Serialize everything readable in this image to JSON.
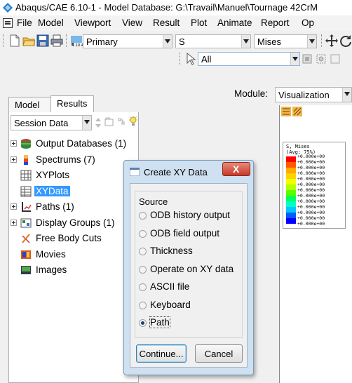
{
  "window": {
    "title": "Abaqus/CAE 6.10-1 - Model Database: G:\\Travail\\Manuel\\Tournage 42CrM"
  },
  "menubar": {
    "items": [
      "File",
      "Model",
      "Viewport",
      "View",
      "Result",
      "Plot",
      "Animate",
      "Report",
      "Op"
    ]
  },
  "toolbar": {
    "render_style": "Primary",
    "variable": "S",
    "invariant": "Mises",
    "selection_filter": "All"
  },
  "tabs": {
    "model": "Model",
    "results": "Results"
  },
  "module": {
    "label": "Module:",
    "value": "Visualization"
  },
  "session": {
    "label": "Session Data"
  },
  "tree": [
    {
      "label": "Output Databases (1)",
      "icon": "database-icon",
      "expandable": true
    },
    {
      "label": "Spectrums (7)",
      "icon": "spectrum-icon",
      "expandable": true
    },
    {
      "label": "XYPlots",
      "icon": "xyplot-icon",
      "expandable": false
    },
    {
      "label": "XYData",
      "icon": "xydata-icon",
      "expandable": false,
      "selected": true
    },
    {
      "label": "Paths (1)",
      "icon": "path-icon",
      "expandable": true
    },
    {
      "label": "Display Groups (1)",
      "icon": "display-group-icon",
      "expandable": true
    },
    {
      "label": "Free Body Cuts",
      "icon": "free-body-cut-icon",
      "expandable": false
    },
    {
      "label": "Movies",
      "icon": "movie-icon",
      "expandable": false
    },
    {
      "label": "Images",
      "icon": "image-icon",
      "expandable": false
    }
  ],
  "legend": {
    "title": "S, Mises",
    "subtitle": "(Avg: 75%)",
    "value": "+0.000e+00",
    "colors": [
      "#ff0000",
      "#ff5a00",
      "#ffaa00",
      "#ffd200",
      "#f0ff00",
      "#b4ff00",
      "#5aff00",
      "#00ff5a",
      "#00ffc8",
      "#00c8ff",
      "#005aff",
      "#0000ff"
    ]
  },
  "dialog": {
    "title": "Create XY Data",
    "close_label": "X",
    "group_title": "Source",
    "options": [
      {
        "label": "ODB history output",
        "selected": false
      },
      {
        "label": "ODB field output",
        "selected": false
      },
      {
        "label": "Thickness",
        "selected": false
      },
      {
        "label": "Operate on XY data",
        "selected": false
      },
      {
        "label": "ASCII file",
        "selected": false
      },
      {
        "label": "Keyboard",
        "selected": false
      },
      {
        "label": "Path",
        "selected": true
      }
    ],
    "continue_label": "Continue...",
    "cancel_label": "Cancel"
  },
  "colors": {
    "selection": "#3399ff",
    "dialog_frame": "#cfe0f0",
    "close_button": "#c53a2a"
  }
}
